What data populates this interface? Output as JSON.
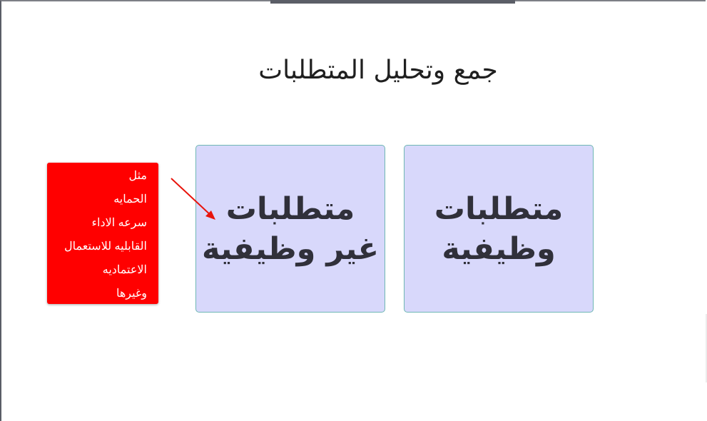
{
  "slide": {
    "title": "جمع وتحليل المتطلبات",
    "boxes": {
      "functional": {
        "line1": "متطلبات",
        "line2": "وظيفية"
      },
      "non_functional": {
        "line1": "متطلبات",
        "line2": "غير وظيفية"
      }
    },
    "note": {
      "lines": [
        "مثل",
        "الحمايه",
        "سرعه الاداء",
        "القابليه للاستعمال",
        "الاعتماديه",
        "وغيرها"
      ]
    }
  },
  "colors": {
    "box_fill": "#d8d8fb",
    "box_border": "#6fb7b4",
    "note_fill": "#ff0000",
    "arrow": "#e8140c"
  }
}
